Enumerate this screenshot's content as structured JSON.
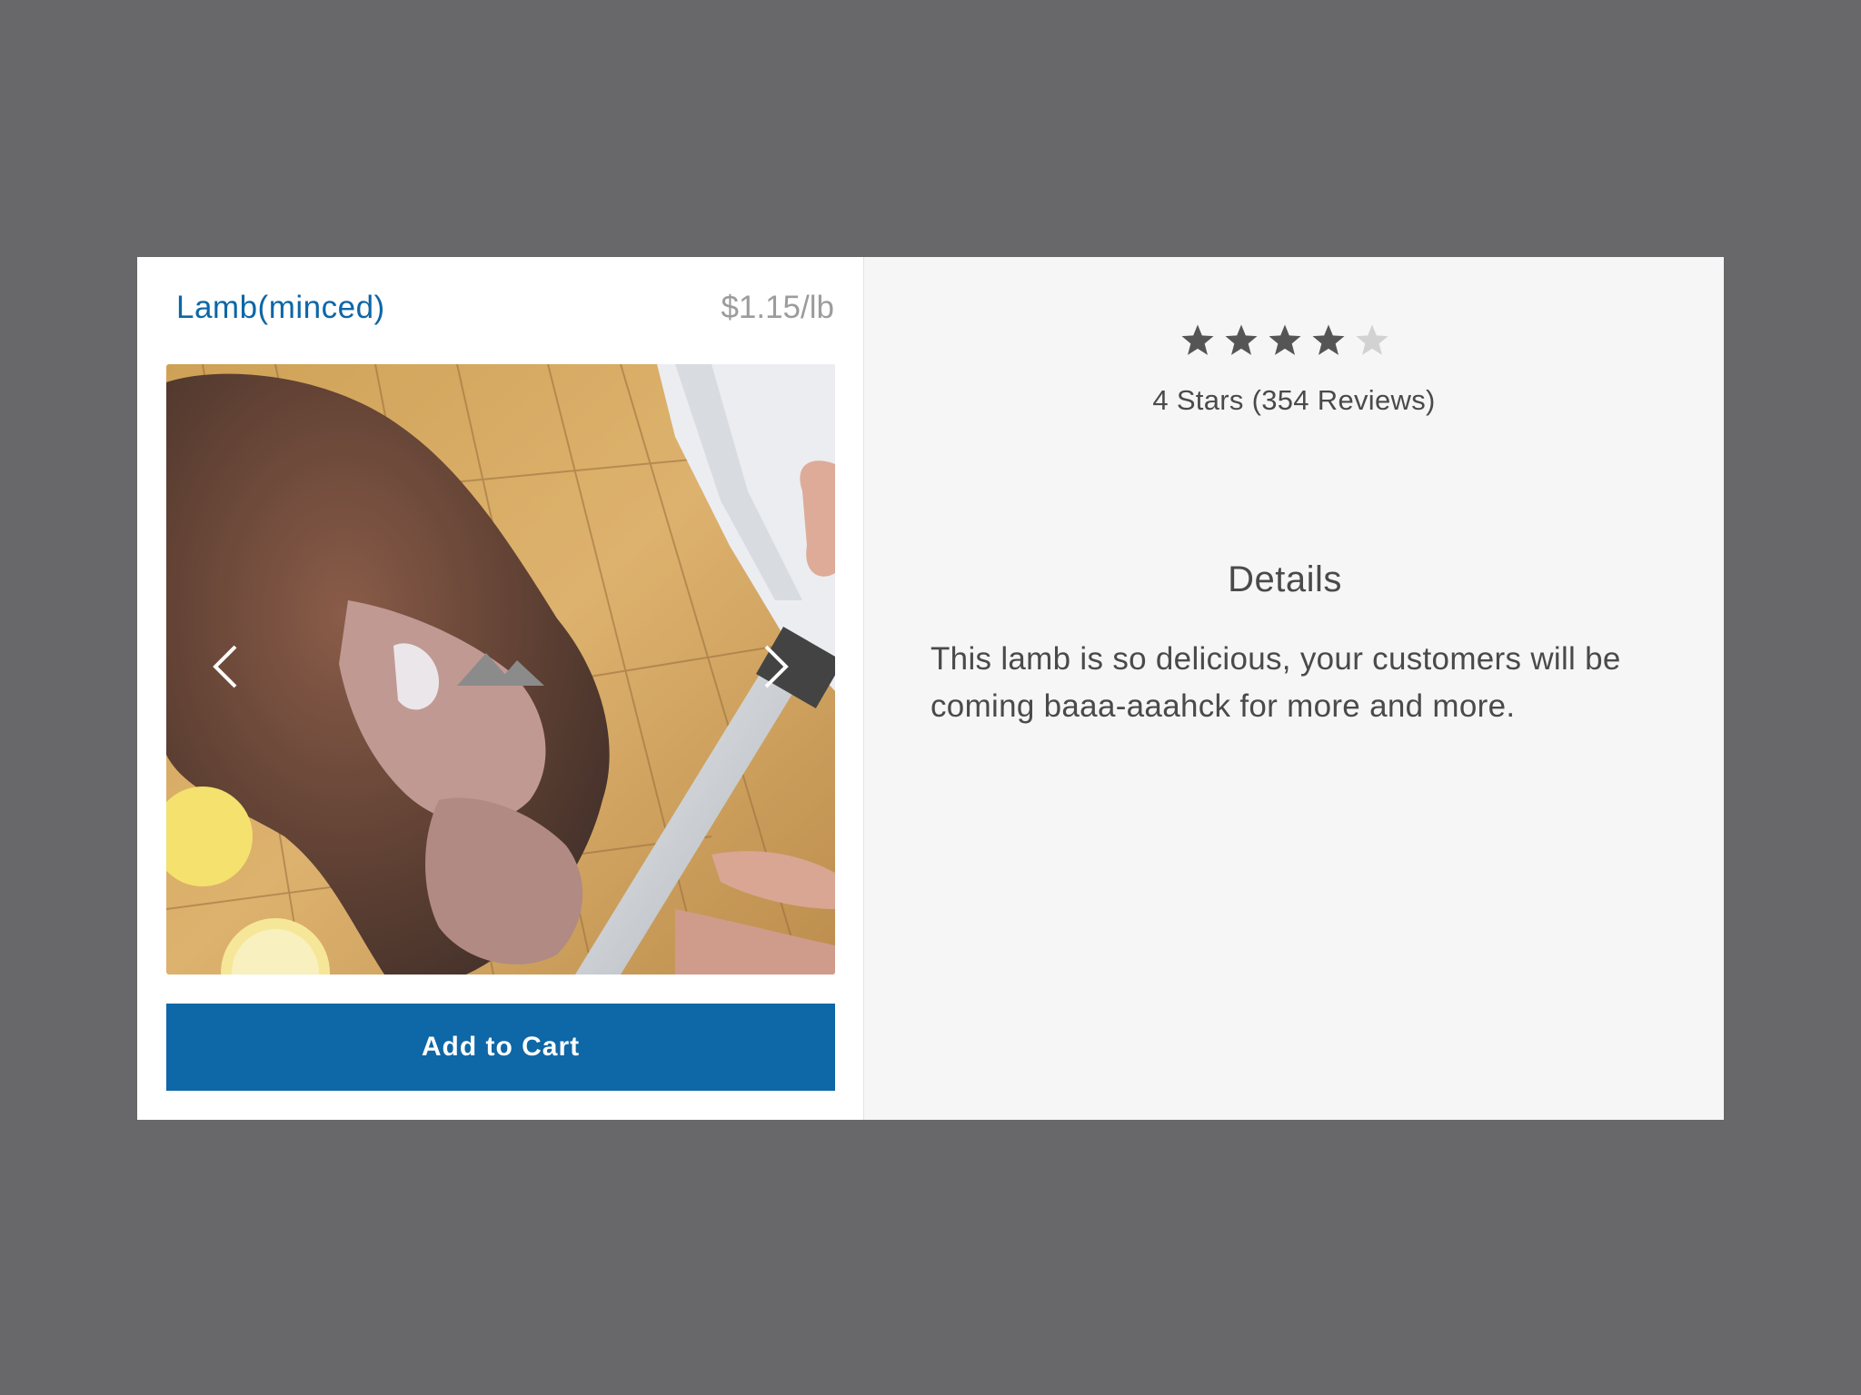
{
  "product": {
    "name": "Lamb(minced)",
    "price": "$1.15/lb",
    "image_description_icon": "image-placeholder-icon"
  },
  "gallery": {
    "prev_icon": "chevron-left-icon",
    "next_icon": "chevron-right-icon"
  },
  "actions": {
    "add_to_cart_label": "Add to Cart"
  },
  "rating": {
    "stars_filled": 4,
    "stars_total": 5,
    "summary": "4 Stars (354 Reviews)"
  },
  "details": {
    "heading": "Details",
    "body": "This lamb is so delicious, your customers will be coming baaa-aaahck for more and more."
  },
  "colors": {
    "accent": "#0e67a6",
    "background": "#68686a",
    "star_filled": "#555555",
    "star_empty": "#d2d2d2"
  }
}
